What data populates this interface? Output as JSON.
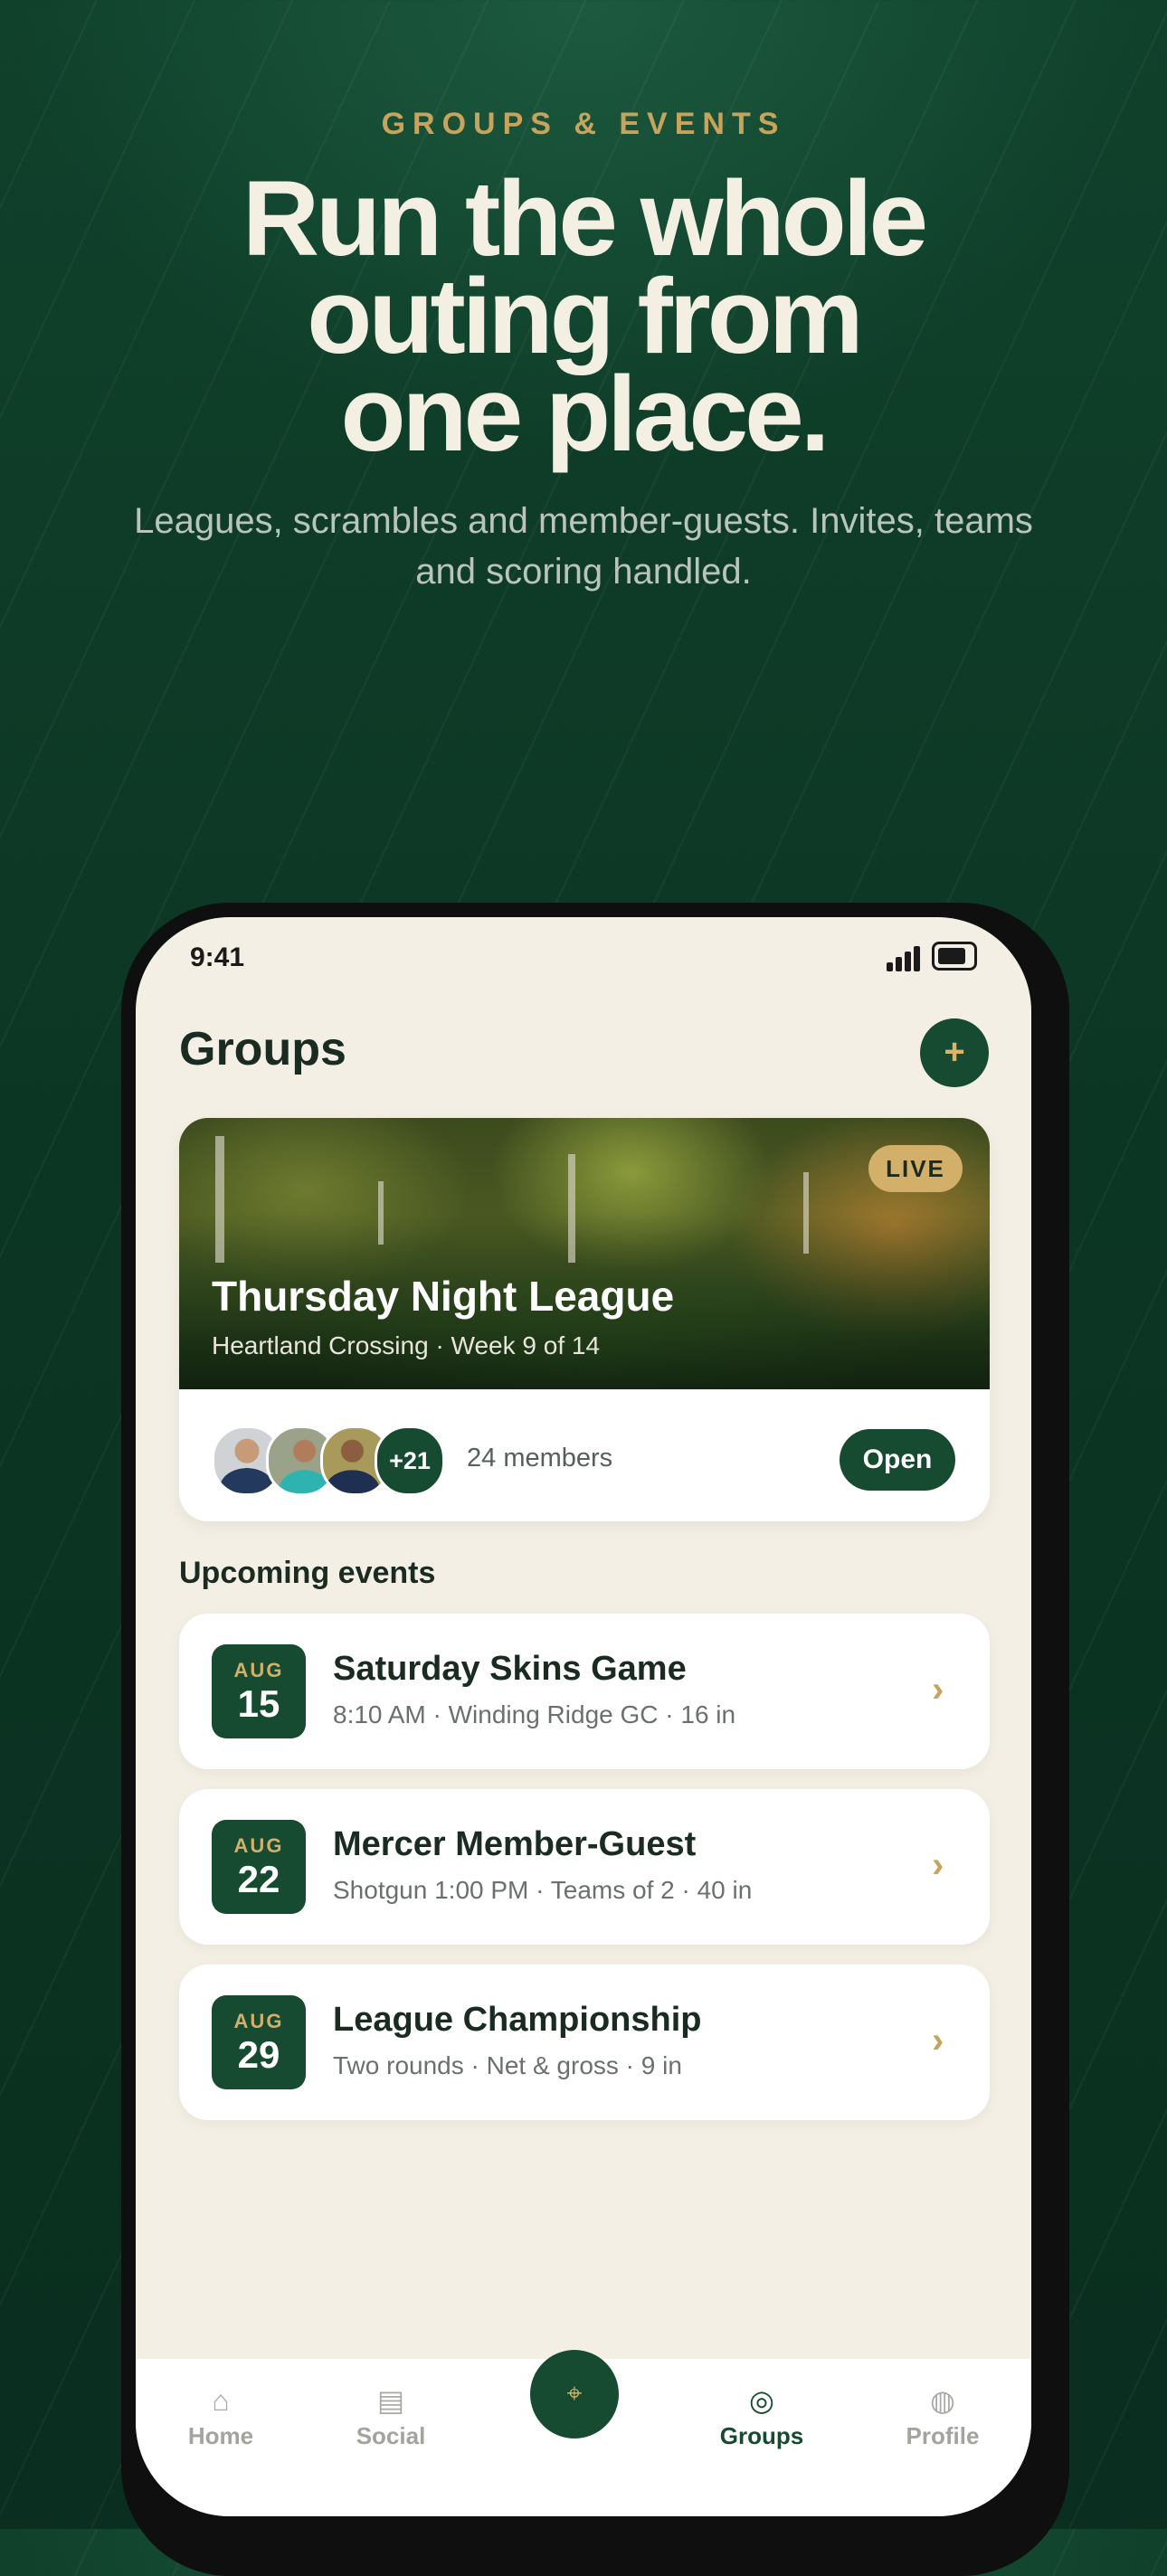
{
  "hero": {
    "eyebrow": "GROUPS & EVENTS",
    "headline_lines": [
      "Run the whole",
      "outing from",
      "one place."
    ],
    "subhead": "Leagues, scrambles and member-guests. Invites, teams and scoring handled."
  },
  "status_bar": {
    "time": "9:41"
  },
  "screen": {
    "title": "Groups",
    "add_icon": "plus-icon",
    "league": {
      "badge": "LIVE",
      "name": "Thursday Night League",
      "meta": "Heartland Crossing · Week 9 of 14",
      "more_members": "+21",
      "members": "24 members",
      "open_label": "Open"
    },
    "upcoming_title": "Upcoming events",
    "events": [
      {
        "month": "AUG",
        "day": "15",
        "title": "Saturday Skins Game",
        "sub": "8:10 AM · Winding Ridge GC · 16 in"
      },
      {
        "month": "AUG",
        "day": "22",
        "title": "Mercer Member-Guest",
        "sub": "Shotgun 1:00 PM · Teams of 2 · 40 in"
      },
      {
        "month": "AUG",
        "day": "29",
        "title": "League Championship",
        "sub": "Two rounds · Net & gross · 9 in"
      }
    ],
    "tabbar": {
      "items": [
        {
          "label": "Home",
          "icon": "home-icon"
        },
        {
          "label": "Social",
          "icon": "feed-icon"
        },
        {
          "label": "",
          "icon": "flag-pin-icon"
        },
        {
          "label": "Groups",
          "icon": "groups-icon"
        },
        {
          "label": "Profile",
          "icon": "profile-icon"
        }
      ],
      "active": "Groups"
    }
  },
  "colors": {
    "background": "#0c3624",
    "accent_gold": "#c8a35c",
    "brand_green": "#164a31",
    "screen_bg": "#f4efe4"
  }
}
